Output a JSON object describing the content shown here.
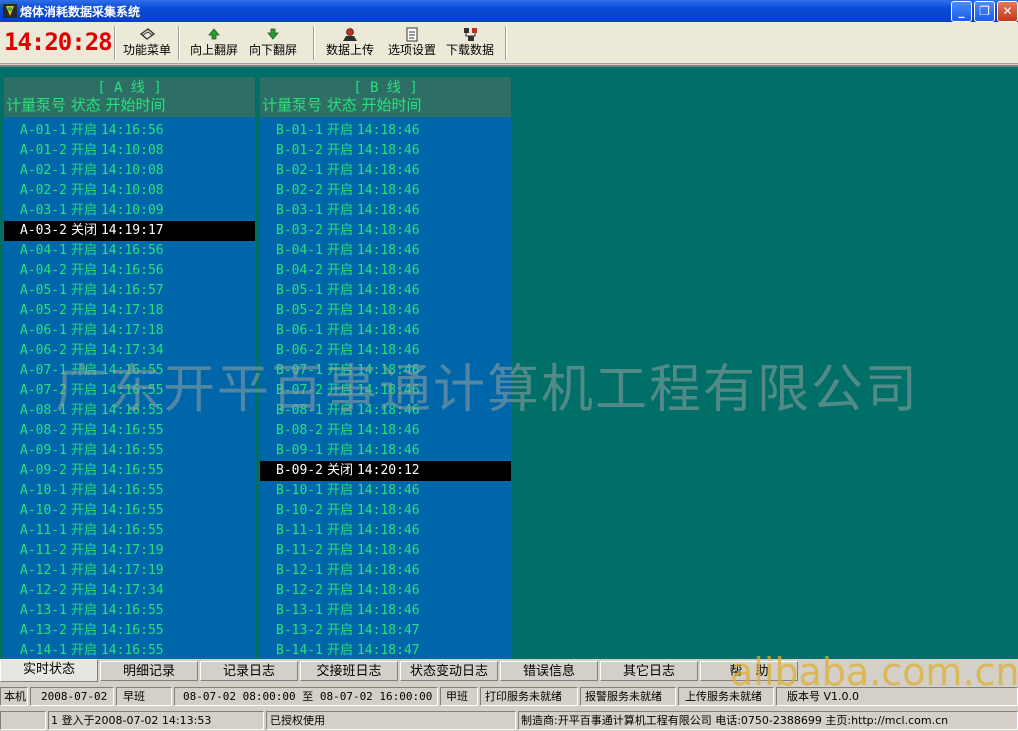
{
  "window": {
    "title": "熔体消耗数据采集系统",
    "minimize_glyph": "_",
    "restore_glyph": "❐",
    "close_glyph": "✕"
  },
  "toolbar": {
    "clock": "14:20:28",
    "buttons": [
      {
        "label": "功能菜单",
        "icon": "menu-icon"
      },
      {
        "label": "向上翻屏",
        "icon": "arrow-up-icon"
      },
      {
        "label": "向下翻屏",
        "icon": "arrow-down-icon"
      },
      {
        "label": "数据上传",
        "icon": "upload-icon"
      },
      {
        "label": "选项设置",
        "icon": "settings-icon"
      },
      {
        "label": "下载数据",
        "icon": "download-icon"
      }
    ]
  },
  "line_a": {
    "name": "[ A 线 ]",
    "columns": "计量泵号 状态 开始时间",
    "rows": [
      {
        "id": "A-01-1",
        "state": "开启",
        "time": "14:16:56"
      },
      {
        "id": "A-01-2",
        "state": "开启",
        "time": "14:10:08"
      },
      {
        "id": "A-02-1",
        "state": "开启",
        "time": "14:10:08"
      },
      {
        "id": "A-02-2",
        "state": "开启",
        "time": "14:10:08"
      },
      {
        "id": "A-03-1",
        "state": "开启",
        "time": "14:10:09"
      },
      {
        "id": "A-03-2",
        "state": "关闭",
        "time": "14:19:17"
      },
      {
        "id": "A-04-1",
        "state": "开启",
        "time": "14:16:56"
      },
      {
        "id": "A-04-2",
        "state": "开启",
        "time": "14:16:56"
      },
      {
        "id": "A-05-1",
        "state": "开启",
        "time": "14:16:57"
      },
      {
        "id": "A-05-2",
        "state": "开启",
        "time": "14:17:18"
      },
      {
        "id": "A-06-1",
        "state": "开启",
        "time": "14:17:18"
      },
      {
        "id": "A-06-2",
        "state": "开启",
        "time": "14:17:34"
      },
      {
        "id": "A-07-1",
        "state": "开启",
        "time": "14:16:55"
      },
      {
        "id": "A-07-2",
        "state": "开启",
        "time": "14:16:55"
      },
      {
        "id": "A-08-1",
        "state": "开启",
        "time": "14:16:55"
      },
      {
        "id": "A-08-2",
        "state": "开启",
        "time": "14:16:55"
      },
      {
        "id": "A-09-1",
        "state": "开启",
        "time": "14:16:55"
      },
      {
        "id": "A-09-2",
        "state": "开启",
        "time": "14:16:55"
      },
      {
        "id": "A-10-1",
        "state": "开启",
        "time": "14:16:55"
      },
      {
        "id": "A-10-2",
        "state": "开启",
        "time": "14:16:55"
      },
      {
        "id": "A-11-1",
        "state": "开启",
        "time": "14:16:55"
      },
      {
        "id": "A-11-2",
        "state": "开启",
        "time": "14:17:19"
      },
      {
        "id": "A-12-1",
        "state": "开启",
        "time": "14:17:19"
      },
      {
        "id": "A-12-2",
        "state": "开启",
        "time": "14:17:34"
      },
      {
        "id": "A-13-1",
        "state": "开启",
        "time": "14:16:55"
      },
      {
        "id": "A-13-2",
        "state": "开启",
        "time": "14:16:55"
      },
      {
        "id": "A-14-1",
        "state": "开启",
        "time": "14:16:55"
      }
    ]
  },
  "line_b": {
    "name": "[ B 线 ]",
    "columns": "计量泵号 状态 开始时间",
    "rows": [
      {
        "id": "B-01-1",
        "state": "开启",
        "time": "14:18:46"
      },
      {
        "id": "B-01-2",
        "state": "开启",
        "time": "14:18:46"
      },
      {
        "id": "B-02-1",
        "state": "开启",
        "time": "14:18:46"
      },
      {
        "id": "B-02-2",
        "state": "开启",
        "time": "14:18:46"
      },
      {
        "id": "B-03-1",
        "state": "开启",
        "time": "14:18:46"
      },
      {
        "id": "B-03-2",
        "state": "开启",
        "time": "14:18:46"
      },
      {
        "id": "B-04-1",
        "state": "开启",
        "time": "14:18:46"
      },
      {
        "id": "B-04-2",
        "state": "开启",
        "time": "14:18:46"
      },
      {
        "id": "B-05-1",
        "state": "开启",
        "time": "14:18:46"
      },
      {
        "id": "B-05-2",
        "state": "开启",
        "time": "14:18:46"
      },
      {
        "id": "B-06-1",
        "state": "开启",
        "time": "14:18:46"
      },
      {
        "id": "B-06-2",
        "state": "开启",
        "time": "14:18:46"
      },
      {
        "id": "B-07-1",
        "state": "开启",
        "time": "14:18:46"
      },
      {
        "id": "B-07-2",
        "state": "开启",
        "time": "14:18:46"
      },
      {
        "id": "B-08-1",
        "state": "开启",
        "time": "14:18:46"
      },
      {
        "id": "B-08-2",
        "state": "开启",
        "time": "14:18:46"
      },
      {
        "id": "B-09-1",
        "state": "开启",
        "time": "14:18:46"
      },
      {
        "id": "B-09-2",
        "state": "关闭",
        "time": "14:20:12"
      },
      {
        "id": "B-10-1",
        "state": "开启",
        "time": "14:18:46"
      },
      {
        "id": "B-10-2",
        "state": "开启",
        "time": "14:18:46"
      },
      {
        "id": "B-11-1",
        "state": "开启",
        "time": "14:18:46"
      },
      {
        "id": "B-11-2",
        "state": "开启",
        "time": "14:18:46"
      },
      {
        "id": "B-12-1",
        "state": "开启",
        "time": "14:18:46"
      },
      {
        "id": "B-12-2",
        "state": "开启",
        "time": "14:18:46"
      },
      {
        "id": "B-13-1",
        "state": "开启",
        "time": "14:18:46"
      },
      {
        "id": "B-13-2",
        "state": "开启",
        "time": "14:18:47"
      },
      {
        "id": "B-14-1",
        "state": "开启",
        "time": "14:18:47"
      }
    ]
  },
  "watermark": "广东开平百事通计算机工程有限公司",
  "site_watermark": "alibaba.com.cn",
  "tabs": [
    "实时状态",
    "明细记录",
    "记录日志",
    "交接班日志",
    "状态变动日志",
    "错误信息",
    "其它日志",
    "帮　助"
  ],
  "status1": {
    "host": "本机",
    "date": "2008-07-02",
    "shift": "早班",
    "range": "08-07-02 08:00:00 至 08-07-02 16:00:00",
    "team": "甲班",
    "print_service": "打印服务未就绪",
    "alarm_service": "报警服务未就绪",
    "upload_service": "上传服务未就绪",
    "version": "版本号 V1.0.0"
  },
  "status2": {
    "login": "1 登入于2008-07-02 14:13:53",
    "license": "已授权使用",
    "maker": "制造商:开平百事通计算机工程有限公司 电话:0750-2388699 主页:http://mcl.com.cn"
  },
  "colors": {
    "accent_green": "#29e07d",
    "panel_blue": "#0066aa",
    "background_teal": "#006f68",
    "clock_red": "#e00000"
  }
}
